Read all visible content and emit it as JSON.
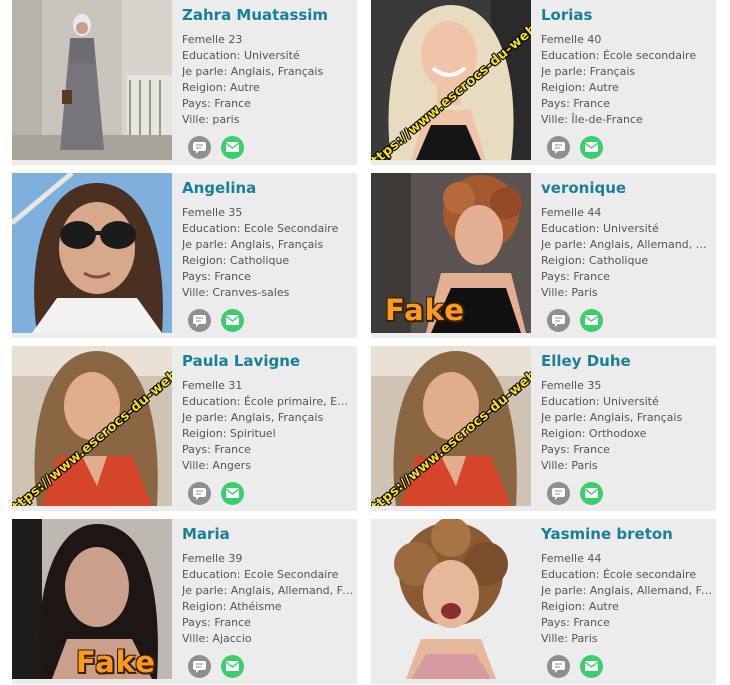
{
  "watermark": "https://www.escrocs-du-web.fr",
  "fake_label": "Fake",
  "profiles": [
    {
      "name": "Zahra Muatassim",
      "gender_age": "Femelle 23",
      "education": "Education: Université",
      "languages": "Je parle: Anglais, Français",
      "religion": "Reigion: Autre",
      "country": "Pays: France",
      "city": "Ville: paris"
    },
    {
      "name": "Lorias",
      "gender_age": "Femelle 40",
      "education": "Education: École secondaire",
      "languages": "Je parle: Français",
      "religion": "Reigion: Autre",
      "country": "Pays: France",
      "city": "Ville: Île-de-France"
    },
    {
      "name": "Angelina",
      "gender_age": "Femelle 35",
      "education": "Education: Ecole Secondaire",
      "languages": "Je parle: Anglais, Français",
      "religion": "Reigion: Catholique",
      "country": "Pays: France",
      "city": "Ville: Cranves-sales"
    },
    {
      "name": "veronique",
      "gender_age": "Femelle 44",
      "education": "Education: Université",
      "languages": "Je parle: Anglais, Allemand, S...",
      "religion": "Reigion: Catholique",
      "country": "Pays: France",
      "city": "Ville: Paris"
    },
    {
      "name": "Paula Lavigne",
      "gender_age": "Femelle 31",
      "education": "Education: École primaire, Eco...",
      "languages": "Je parle: Anglais, Français",
      "religion": "Reigion: Spirituel",
      "country": "Pays: France",
      "city": "Ville: Angers"
    },
    {
      "name": "Elley Duhe",
      "gender_age": "Femelle 35",
      "education": "Education: Université",
      "languages": "Je parle: Anglais, Français",
      "religion": "Reigion: Orthodoxe",
      "country": "Pays: France",
      "city": "Ville: Paris"
    },
    {
      "name": "Maria",
      "gender_age": "Femelle 39",
      "education": "Education: Ecole Secondaire",
      "languages": "Je parle: Anglais, Allemand, Fr...",
      "religion": "Reigion: Athéisme",
      "country": "Pays: France",
      "city": "Ville: Ajaccio"
    },
    {
      "name": "Yasmine breton",
      "gender_age": "Femelle 44",
      "education": "Education: École secondaire",
      "languages": "Je parle: Anglais, Allemand, Fr...",
      "religion": "Reigion: Autre",
      "country": "Pays: France",
      "city": "Ville: Paris"
    }
  ],
  "icons": {
    "chat": "chat-bubble-icon",
    "mail": "envelope-icon"
  },
  "colors": {
    "name": "#1a7f9a",
    "card_bg": "#ececec",
    "chat_button": "#8f8f8f",
    "mail_button": "#3ccd6d",
    "watermark": "#f6e400",
    "fake": "#ff9a1c"
  }
}
